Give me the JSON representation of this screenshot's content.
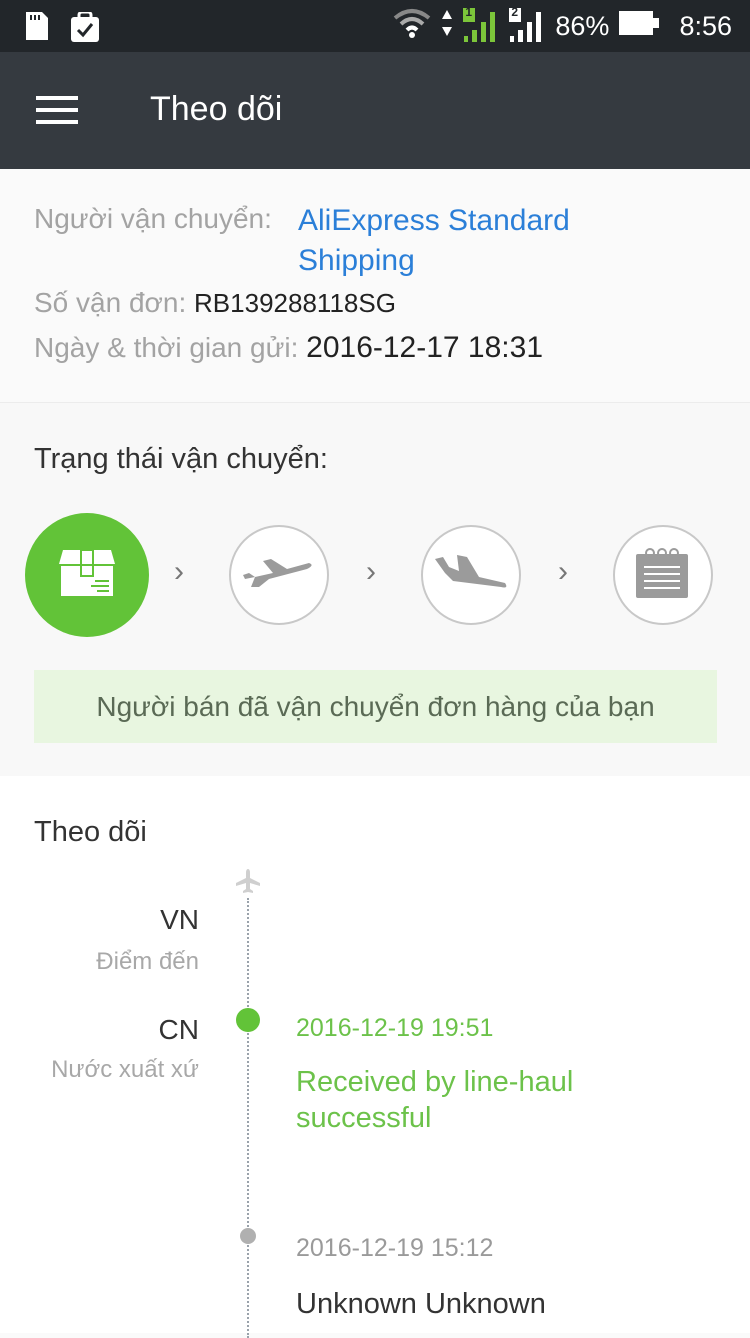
{
  "status_bar": {
    "left_icons": [
      "sd-card-icon",
      "clipboard-check-icon"
    ],
    "right_icons": [
      "wifi-icon",
      "data-arrows-icon",
      "sim1-signal-icon",
      "sim2-signal-icon"
    ],
    "sim1_label": "1",
    "sim2_label": "2",
    "battery": "86%",
    "time": "8:56"
  },
  "app_bar": {
    "menu_icon": "hamburger-menu-icon",
    "title": "Theo dõi"
  },
  "info": {
    "carrier_label": "Người vận chuyển:",
    "carrier_value": "AliExpress Standard Shipping",
    "tracking_label": "Số vận đơn:",
    "tracking_value": "RB139288118SG",
    "shipped_label": "Ngày & thời gian gửi:",
    "shipped_value": "2016-12-17 18:31"
  },
  "shipping_status": {
    "title": "Trạng thái vận chuyển:",
    "steps": [
      {
        "icon": "package-icon",
        "active": true
      },
      {
        "icon": "plane-takeoff-icon",
        "active": false
      },
      {
        "icon": "plane-landing-icon",
        "active": false
      },
      {
        "icon": "notepad-icon",
        "active": false
      }
    ],
    "banner": "Người bán đã vận chuyển đơn hàng của bạn"
  },
  "tracking": {
    "title": "Theo dõi",
    "destination": {
      "code": "VN",
      "label": "Điểm đến"
    },
    "origin": {
      "code": "CN",
      "label": "Nước xuất xứ"
    },
    "events": [
      {
        "time": "2016-12-19 19:51",
        "description": "Received by line-haul successful",
        "latest": true
      },
      {
        "time": "2016-12-19 15:12",
        "description": "Unknown Unknown",
        "latest": false
      }
    ]
  },
  "colors": {
    "accent_green": "#62c338",
    "link_blue": "#2b7fd8",
    "appbar": "#353a40",
    "statusbar": "#22262a"
  }
}
